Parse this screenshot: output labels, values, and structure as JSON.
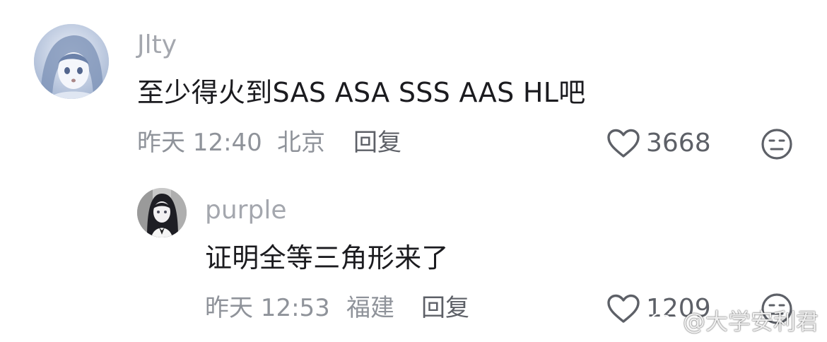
{
  "comments": [
    {
      "username": "Jlty",
      "text": "至少得火到SAS ASA SSS AAS HL吧",
      "time": "昨天 12:40",
      "location": "北京",
      "reply_label": "回复",
      "likes": "3668",
      "avatar_icon": "anime-girl-avatar"
    },
    {
      "username": "purple",
      "text": "证明全等三角形来了",
      "time": "昨天 12:53",
      "location": "福建",
      "reply_label": "回复",
      "likes": "1209",
      "avatar_icon": "anime-girl-dark-hair-avatar"
    }
  ],
  "watermark": {
    "text": "@大学安利君",
    "icon": "weibo-icon"
  },
  "colors": {
    "username": "#a4a7ae",
    "text": "#1b1b1f",
    "meta": "#8f939a",
    "icon": "#5d6067"
  }
}
